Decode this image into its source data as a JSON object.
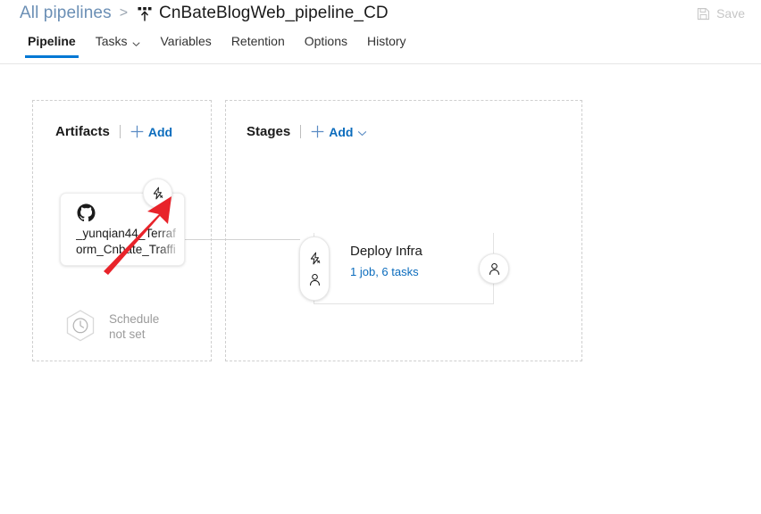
{
  "header": {
    "breadcrumb_parent": "All pipelines",
    "breadcrumb_separator": ">",
    "pipeline_icon": "release-pipeline-icon",
    "title": "CnBateBlogWeb_pipeline_CD",
    "save": {
      "label": "Save",
      "icon": "save-floppy-icon",
      "disabled": true,
      "color": "#c6c6c6"
    }
  },
  "tabs": [
    {
      "label": "Pipeline",
      "active": true,
      "has_chevron": false
    },
    {
      "label": "Tasks",
      "active": false,
      "has_chevron": true
    },
    {
      "label": "Variables",
      "active": false,
      "has_chevron": false
    },
    {
      "label": "Retention",
      "active": false,
      "has_chevron": false
    },
    {
      "label": "Options",
      "active": false,
      "has_chevron": false
    },
    {
      "label": "History",
      "active": false,
      "has_chevron": false
    }
  ],
  "artifacts_panel": {
    "title": "Artifacts",
    "add_label": "Add",
    "add_icon": "plus-icon",
    "artifact": {
      "source_icon": "github-icon",
      "name": "_yunqian44_Terraform_Cnbate_Traffi",
      "trigger_badge_icon": "lightning-bolt-icon",
      "trigger_badge_title": "continuous-deployment-trigger"
    },
    "schedule": {
      "icon": "hexagon-clock-icon",
      "line1": "Schedule",
      "line2": "not set"
    }
  },
  "stages_panel": {
    "title": "Stages",
    "add_label": "Add",
    "add_icon": "plus-icon",
    "add_chevron_icon": "chevron-down-icon",
    "stage": {
      "name": "Deploy Infra",
      "subtitle": "1 job, 6 tasks",
      "top_bar_color": "#0a7bd4",
      "pre_badge_icons": [
        "lightning-bolt-icon",
        "person-icon"
      ],
      "post_badge_icon": "person-icon"
    }
  },
  "annotation": {
    "arrow_color": "#e8232a",
    "points_to": "Add"
  },
  "colors": {
    "accent_blue": "#0078d4",
    "link_blue": "#0b6cbd",
    "breadcrumb_blue": "#6b8fb5",
    "muted_grey": "#9b9b9b",
    "panel_border": "#cfcfcf"
  }
}
